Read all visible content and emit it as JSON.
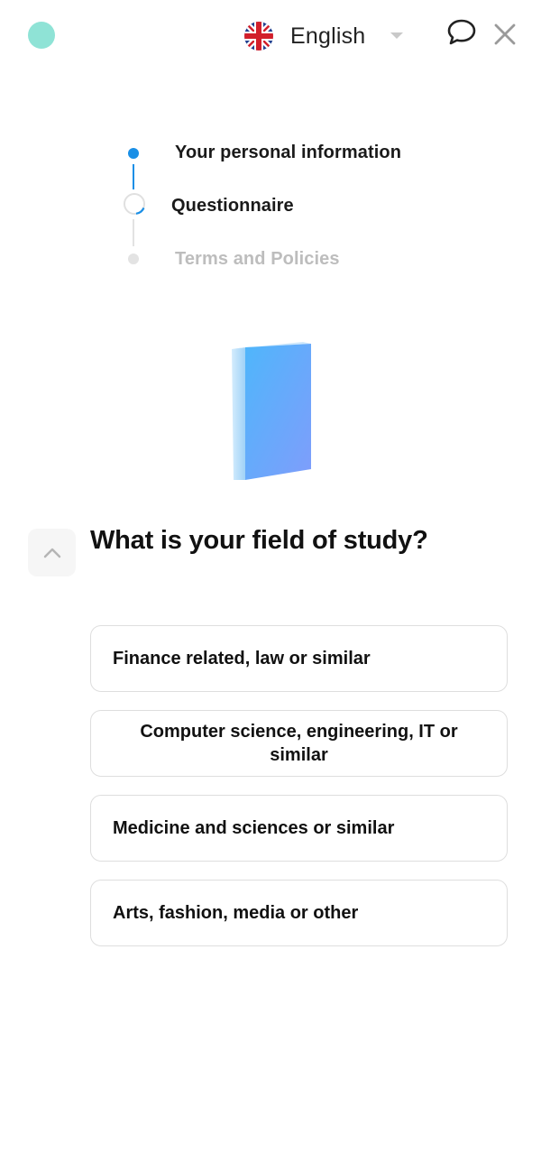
{
  "header": {
    "language_label": "English",
    "language_flag": "uk-flag-icon",
    "chat_icon": "chat-bubble-icon",
    "close_icon": "close-icon"
  },
  "steps": [
    {
      "label": "Your personal information",
      "state": "completed"
    },
    {
      "label": "Questionnaire",
      "state": "current"
    },
    {
      "label": "Terms and Policies",
      "state": "upcoming"
    }
  ],
  "question": {
    "text": "What is your field of study?",
    "illustration": "book-icon",
    "back_icon": "chevron-up-icon"
  },
  "options": [
    "Finance related, law or similar",
    "Computer science, engineering, IT or similar",
    "Medicine and sciences or similar",
    "Arts, fashion, media or other"
  ],
  "colors": {
    "logo": "#8fe3d6",
    "accent": "#1a8fe6",
    "muted": "#bdbdbd",
    "border": "#dedede"
  }
}
